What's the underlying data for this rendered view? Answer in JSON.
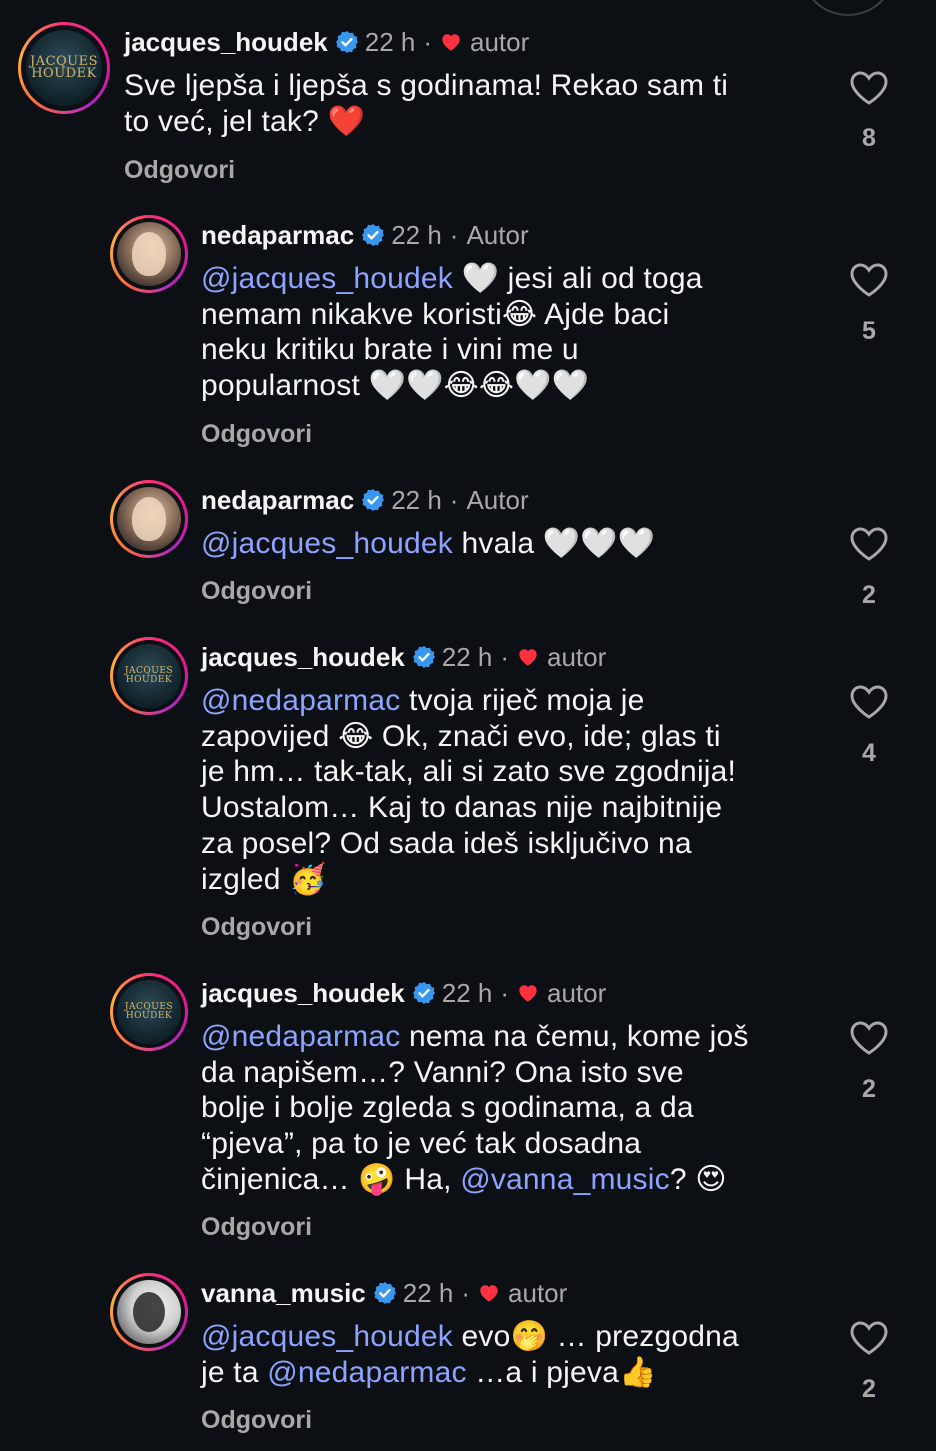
{
  "colors": {
    "background": "#0c1014",
    "text": "#f5f5f5",
    "muted": "#a8a8a8",
    "mention": "#8ea3ff",
    "verified": "#3897f0",
    "heart": "#ff3040"
  },
  "comments": [
    {
      "username": "jacques_houdek",
      "time": "22 h",
      "author_label": "autor",
      "author_heart": true,
      "avatar_logo": "JACQUES HOUDEK",
      "text_parts": [
        {
          "t": "Sve ljepša i ljepša s godinama! Rekao sam ti"
        },
        {
          "t": "to već, jel tak? ❤️"
        }
      ],
      "reply_label": "Odgovori",
      "likes": "8"
    },
    {
      "username": "nedaparmac",
      "time": "22 h",
      "author_label": "Autor",
      "author_heart": false,
      "mention": "@jacques_houdek",
      "line1_rest": " 🤍 jesi ali od toga",
      "line2": "nemam nikakve koristi😂 Ajde baci",
      "line3": "neku kritiku brate i vini me u",
      "line4": "popularnost 🤍🤍😂😂🤍🤍",
      "reply_label": "Odgovori",
      "likes": "5"
    },
    {
      "username": "nedaparmac",
      "time": "22 h",
      "author_label": "Autor",
      "author_heart": false,
      "mention": "@jacques_houdek",
      "line1_rest": " hvala 🤍🤍🤍",
      "reply_label": "Odgovori",
      "likes": "2"
    },
    {
      "username": "jacques_houdek",
      "time": "22 h",
      "author_label": "autor",
      "author_heart": true,
      "avatar_logo": "JACQUES HOUDEK",
      "mention": "@nedaparmac",
      "line1_rest": " tvoja riječ moja je",
      "line2": "zapovijed 😂 Ok, znači evo, ide; glas ti",
      "line3": "je hm… tak-tak, ali si zato sve zgodnija!",
      "line4": "Uostalom… Kaj to danas nije najbitnije",
      "line5": "za posel? Od sada ideš isključivo na",
      "line6": "izgled 🥳",
      "reply_label": "Odgovori",
      "likes": "4"
    },
    {
      "username": "jacques_houdek",
      "time": "22 h",
      "author_label": "autor",
      "author_heart": true,
      "avatar_logo": "JACQUES HOUDEK",
      "mention": "@nedaparmac",
      "line1_rest": " nema na čemu, kome još",
      "line2": "da napišem…? Vanni? Ona isto sve",
      "line3": "bolje i bolje zgleda s godinama, a da",
      "line4": "“pjeva”, pa to je već tak dosadna",
      "line5_pre": "činjenica… 🤪 Ha, ",
      "line5_mention": "@vanna_music",
      "line5_post": "? 😍",
      "reply_label": "Odgovori",
      "likes": "2"
    },
    {
      "username": "vanna_music",
      "time": "22 h",
      "author_label": "autor",
      "author_heart": true,
      "mention": "@jacques_houdek",
      "line1_rest": " evo🤭 … prezgodna",
      "line2_pre": "je ta ",
      "line2_mention": "@nedaparmac",
      "line2_post": " …a i pjeva👍",
      "reply_label": "Odgovori",
      "likes": "2"
    }
  ]
}
